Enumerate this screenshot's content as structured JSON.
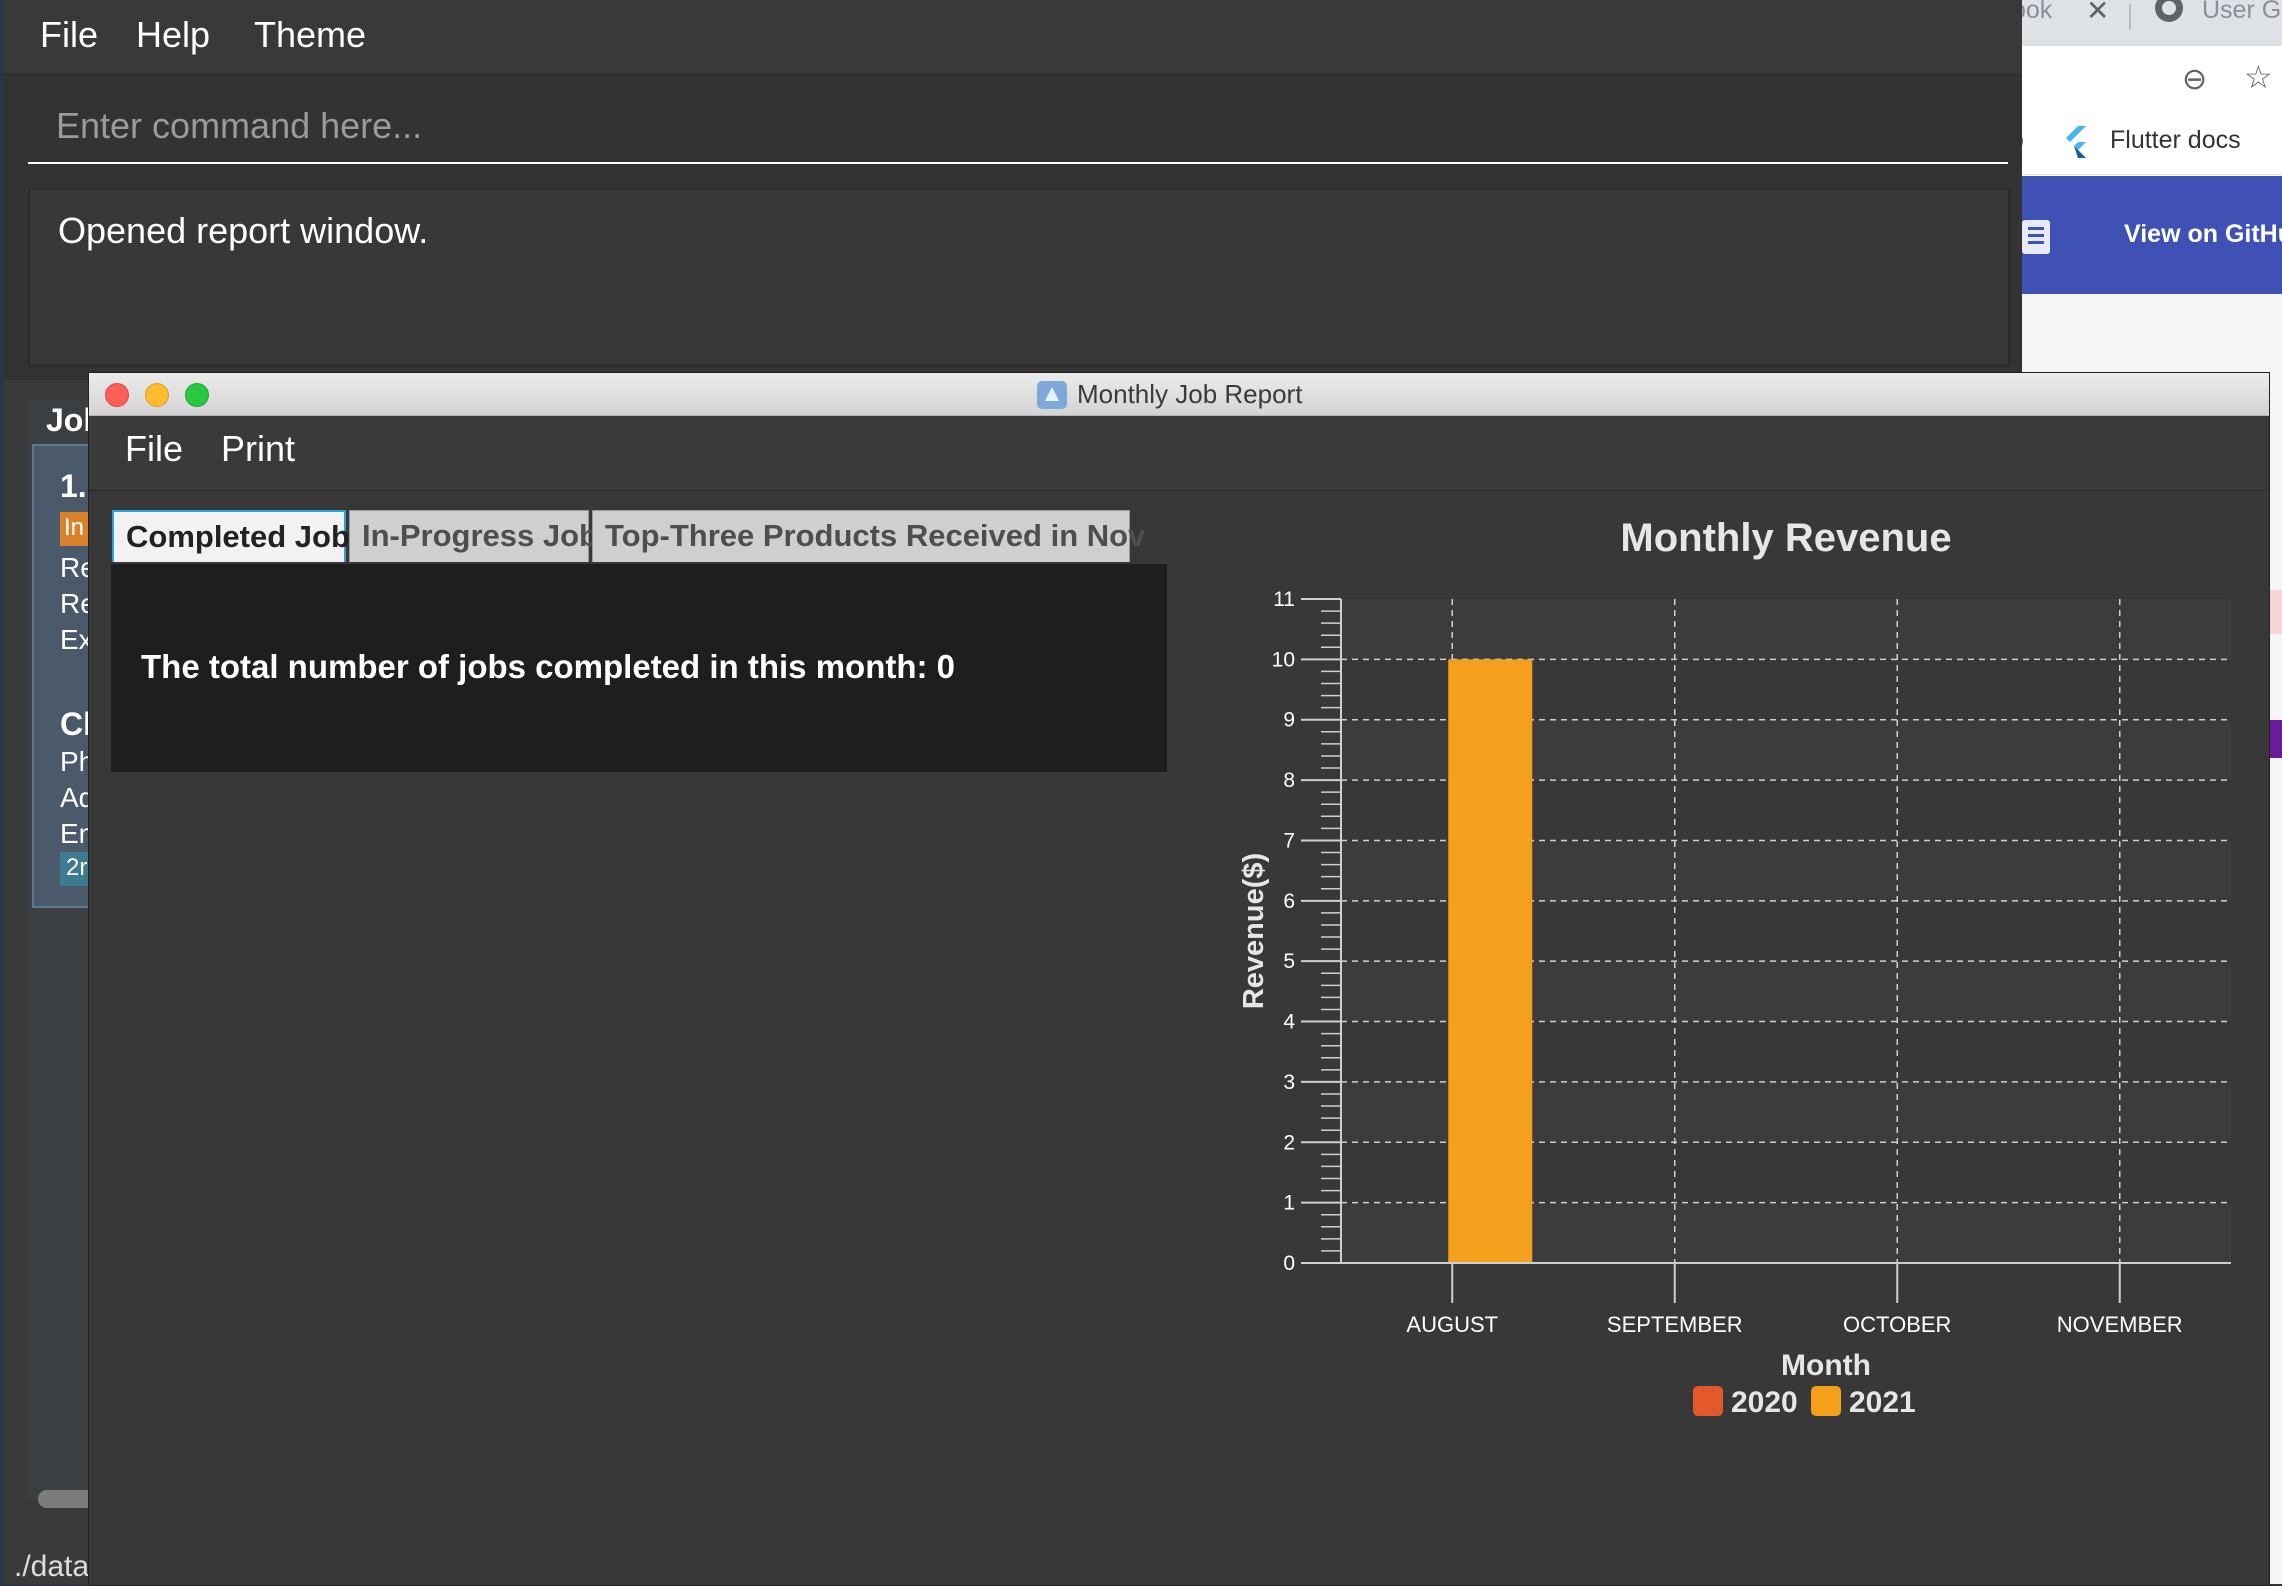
{
  "browser": {
    "tab1_label": "ook",
    "tab2_label": "User G",
    "bookmark_label": "Flutter docs",
    "bookmark_prefix": "o",
    "github_label": "View on GitHu"
  },
  "main_window": {
    "menu": [
      "File",
      "Help",
      "Theme"
    ],
    "command_placeholder": "Enter command here...",
    "result_text": "Opened report window.",
    "job_list_title": "Job",
    "card_index": "1.",
    "card_badge": "In",
    "card_lines": [
      "Re",
      "Re",
      "Ex"
    ],
    "card_client": "Cl",
    "card_details": [
      "Ph",
      "Ad",
      "En"
    ],
    "card_tag": "2r",
    "status_path": "./data"
  },
  "report_window": {
    "title": "Monthly Job Report",
    "menu": [
      "File",
      "Print"
    ],
    "tabs": [
      "Completed Job",
      "In-Progress Job",
      "Top-Three Products Received in Nov"
    ],
    "active_tab": 0,
    "content_text": "The total number of jobs completed in this month: 0"
  },
  "chart_data": {
    "type": "bar",
    "title": "Monthly Revenue",
    "xlabel": "Month",
    "ylabel": "Revenue($)",
    "categories": [
      "AUGUST",
      "SEPTEMBER",
      "OCTOBER",
      "NOVEMBER"
    ],
    "series": [
      {
        "name": "2020",
        "color": "#e3592c",
        "values": [
          0,
          0,
          0,
          0
        ]
      },
      {
        "name": "2021",
        "color": "#f5a01d",
        "values": [
          10,
          0,
          0,
          0
        ]
      }
    ],
    "ylim": [
      0,
      11
    ],
    "yticks": [
      "0",
      "1",
      "2",
      "3",
      "4",
      "5",
      "6",
      "7",
      "8",
      "9",
      "10",
      "11"
    ],
    "grid": true,
    "legend_position": "bottom"
  }
}
